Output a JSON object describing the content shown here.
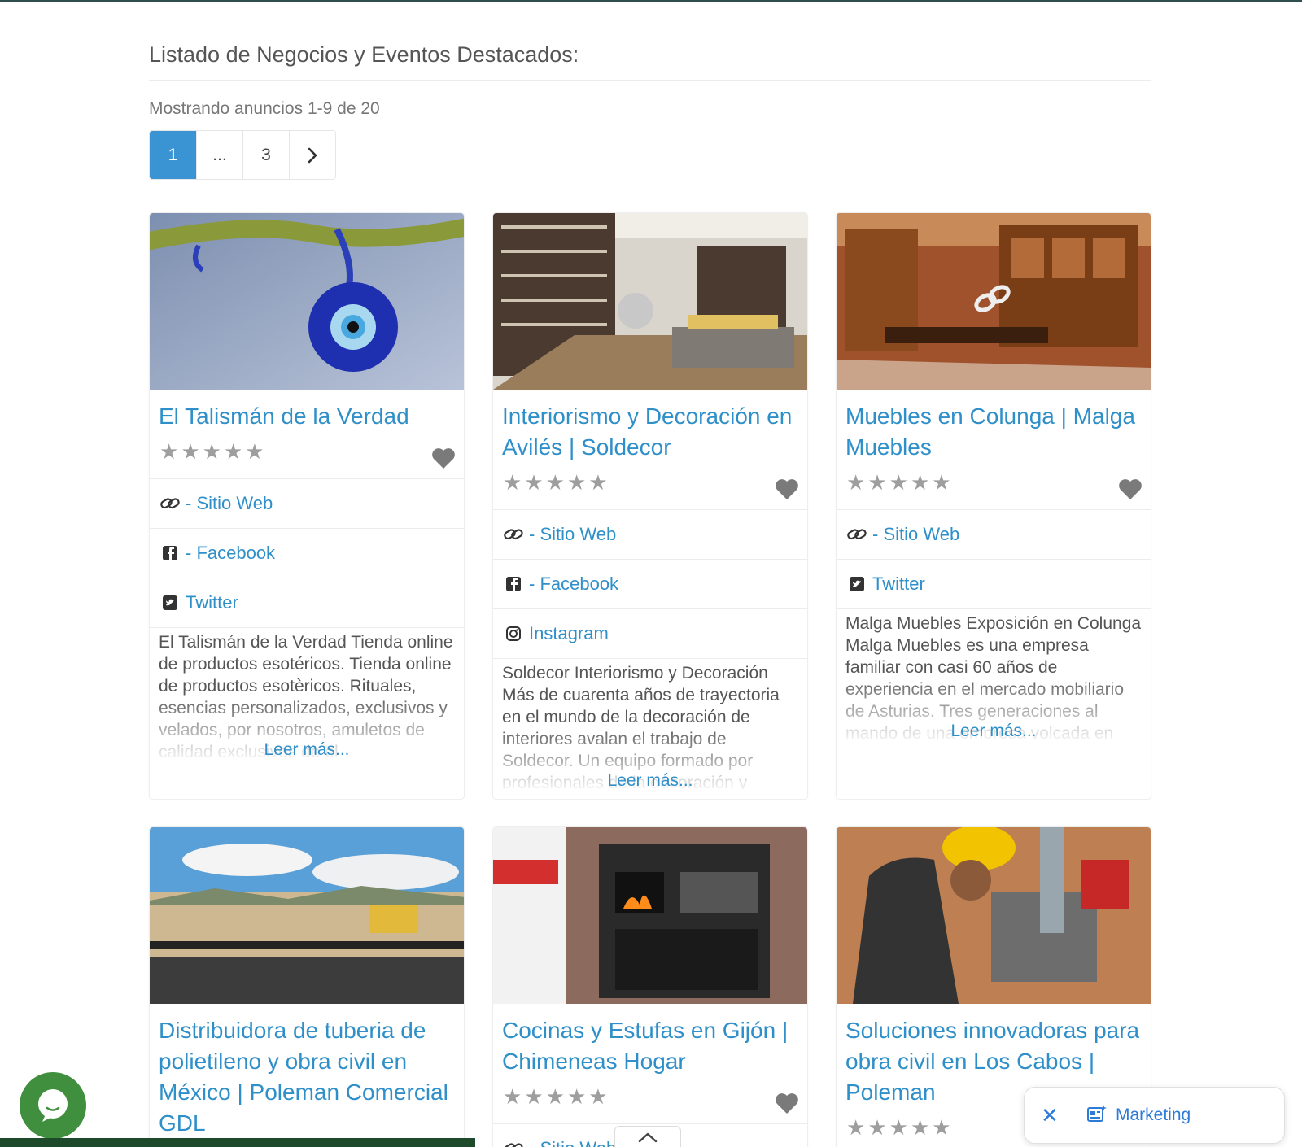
{
  "page": {
    "section_title": "Listado de Negocios y Eventos Destacados:",
    "results_text": "Mostrando anuncios 1-9 de 20"
  },
  "pagination": {
    "items": [
      "1",
      "...",
      "3"
    ],
    "active": "1",
    "next_icon": "chevron-right-icon"
  },
  "cards": [
    {
      "title": "El Talismán de la Verdad",
      "rating": 0,
      "links": [
        {
          "icon": "link-icon",
          "label": "- Sitio Web"
        },
        {
          "icon": "facebook-icon",
          "label": "- Facebook"
        },
        {
          "icon": "twitter-icon",
          "label": "Twitter"
        }
      ],
      "description": "El Talismán de la Verdad Tienda online de productos esotéricos.   Tienda online de productos esotèricos. Rituales, esencias personalizados, exclusivos y velados, por nosotros, amuletos de calidad exclusivos de el",
      "read_more": "Leer más..."
    },
    {
      "title": "Interiorismo y Decoración en Avilés | Soldecor",
      "rating": 0,
      "links": [
        {
          "icon": "link-icon",
          "label": "- Sitio Web"
        },
        {
          "icon": "facebook-icon",
          "label": "- Facebook"
        },
        {
          "icon": "instagram-icon",
          "label": "Instagram"
        }
      ],
      "description": "Soldecor Interiorismo y Decoración Más de cuarenta años de trayectoria en el mundo de la decoración de interiores avalan el trabajo de Soldecor.   Un equipo formado por profesionales de la decoración y",
      "read_more": "Leer más..."
    },
    {
      "title": "Muebles en Colunga | Malga Muebles",
      "rating": 0,
      "links": [
        {
          "icon": "link-icon",
          "label": "- Sitio Web"
        },
        {
          "icon": "twitter-icon",
          "label": "Twitter"
        }
      ],
      "description": "Malga Muebles Exposición en Colunga   Malga Muebles es una empresa familiar con casi 60 años de experiencia en el mercado mobiliario de Asturias. Tres generaciones al mando de una empresa volcada en sus",
      "read_more": "Leer más..."
    },
    {
      "title": "Distribuidora de tuberia de polietileno y obra civil en México | Poleman Comercial GDL",
      "rating": 0,
      "links": [],
      "description": "",
      "read_more": ""
    },
    {
      "title": "Cocinas y Estufas en Gijón | Chimeneas Hogar",
      "rating": 0,
      "links": [
        {
          "icon": "link-icon",
          "label": "- Sitio Web"
        }
      ],
      "description": "",
      "read_more": ""
    },
    {
      "title": "Soluciones innovadoras para obra civil en Los Cabos | Poleman",
      "rating": 0,
      "links": [],
      "description": "",
      "read_more": ""
    }
  ],
  "widgets": {
    "chat_icon": "chat-bubble-icon",
    "marketing_label": "Marketing",
    "close_icon": "close-icon",
    "marketing_icon": "newspaper-sparkle-icon",
    "scroll_top_icon": "chevron-up-icon"
  },
  "colors": {
    "link": "#2f8fc9",
    "pagination_active": "#3a93d3",
    "chat_bubble": "#3f8f3f",
    "stars": "#9e9e9e"
  }
}
